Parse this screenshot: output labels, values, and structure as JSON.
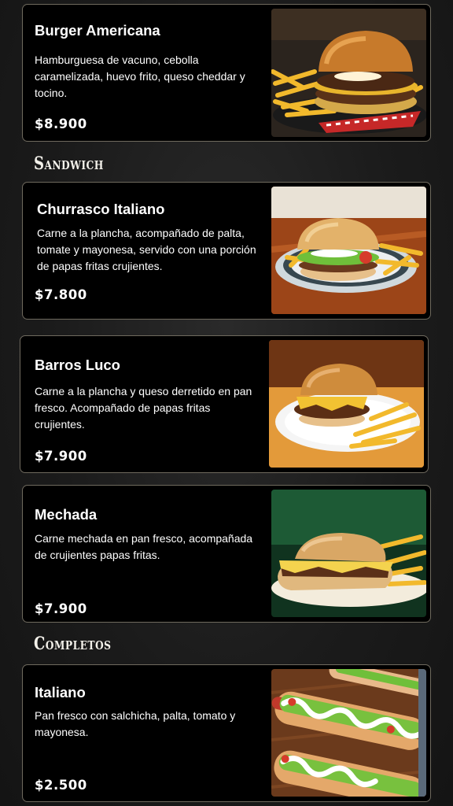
{
  "menu": {
    "items": [
      {
        "name": "Burger Americana",
        "description": "Hamburguesa de vacuno, cebolla caramelizada, huevo frito, queso cheddar y tocino.",
        "price": "$8.900",
        "image_icon": "burger-fries-photo"
      },
      {
        "name": "Churrasco Italiano",
        "description": "Carne a la plancha, acompañado de palta, tomate y mayonesa, servido con una porción de papas fritas crujientes.",
        "price": "$7.800",
        "image_icon": "churrasco-sandwich-photo"
      },
      {
        "name": "Barros Luco",
        "description": "Carne a la plancha y queso derretido en pan fresco. Acompañado de papas fritas crujientes.",
        "price": "$7.900",
        "image_icon": "barros-luco-sandwich-photo"
      },
      {
        "name": "Mechada",
        "description": "Carne mechada en pan fresco, acompañada de crujientes papas fritas.",
        "price": "$7.900",
        "image_icon": "mechada-sandwich-photo"
      },
      {
        "name": "Italiano",
        "description": "Pan fresco con salchicha, palta, tomato y mayonesa.",
        "price": "$2.500",
        "image_icon": "hot-dog-photo"
      }
    ],
    "sections": [
      {
        "title": "Sandwich"
      },
      {
        "title": "Completos"
      }
    ]
  },
  "colors": {
    "card_bg": "#000000",
    "card_border": "#6f6a5e",
    "text": "#ffffff",
    "page_bg": "#1b1b1b"
  }
}
